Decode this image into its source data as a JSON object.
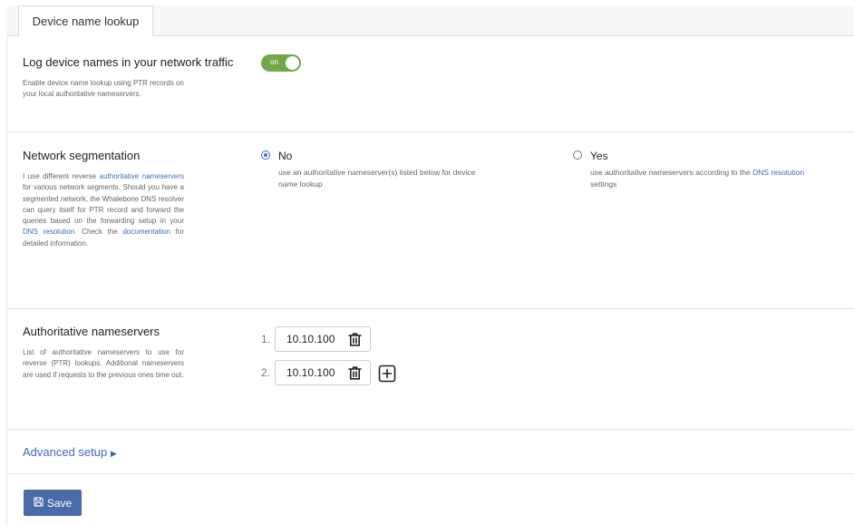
{
  "tab": {
    "label": "Device name lookup"
  },
  "log_section": {
    "title": "Log device names in your network traffic",
    "desc": "Enable device name lookup using PTR records on your local authoritative nameservers.",
    "toggle_label": "on"
  },
  "seg_section": {
    "title": "Network segmentation",
    "desc_1": "I use different reverse ",
    "desc_link_1": "authoritative nameservers",
    "desc_2": " for various network segments. Should you have a segmented network, the Whalebone DNS resolver can query itself for PTR record and forward the queries based on the forwarding setup in your ",
    "desc_link_2": "DNS resolution",
    "desc_3": ". Check the ",
    "desc_link_3": "documentation",
    "desc_4": " for detailed information.",
    "options": [
      {
        "label": "No",
        "desc": "use an authoritative nameserver(s) listed below for device name lookup",
        "selected": true
      },
      {
        "label": "Yes",
        "desc_1": "use authoritative nameservers according to the ",
        "desc_link": "DNS resolution",
        "desc_2": " settings",
        "selected": false
      }
    ]
  },
  "ns_section": {
    "title": "Authoritative nameservers",
    "desc": "List of authoritative nameservers to use for reverse (PTR) lookups. Additional nameservers are used if requests to the previous ones time out.",
    "entries": [
      {
        "num": "1.",
        "value": "10.10.100"
      },
      {
        "num": "2.",
        "value": "10.10.100"
      }
    ]
  },
  "advanced": {
    "label": "Advanced setup"
  },
  "save": {
    "label": "Save"
  }
}
